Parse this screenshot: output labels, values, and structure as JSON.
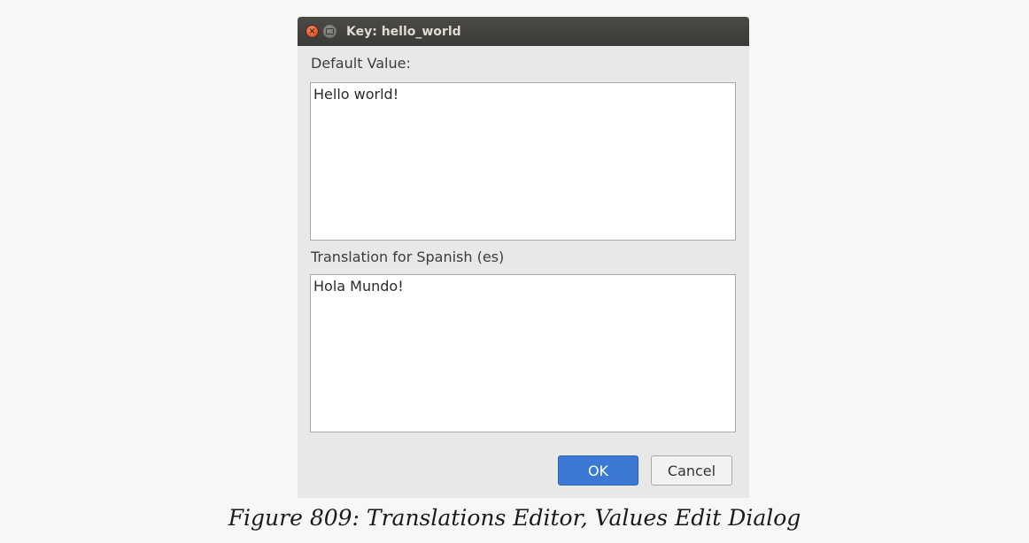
{
  "dialog": {
    "title": "Key: hello_world",
    "close_glyph": "×",
    "default_label": "Default Value:",
    "default_value": "Hello world!",
    "translation_label": "Translation for Spanish (es)",
    "translation_value": "Hola Mundo!",
    "ok_label": "OK",
    "cancel_label": "Cancel"
  },
  "colors": {
    "accent": "#3b79d4",
    "titlebar": "#3f3e3b",
    "close": "#e0552a"
  },
  "caption": "Figure 809: Translations Editor, Values Edit Dialog"
}
